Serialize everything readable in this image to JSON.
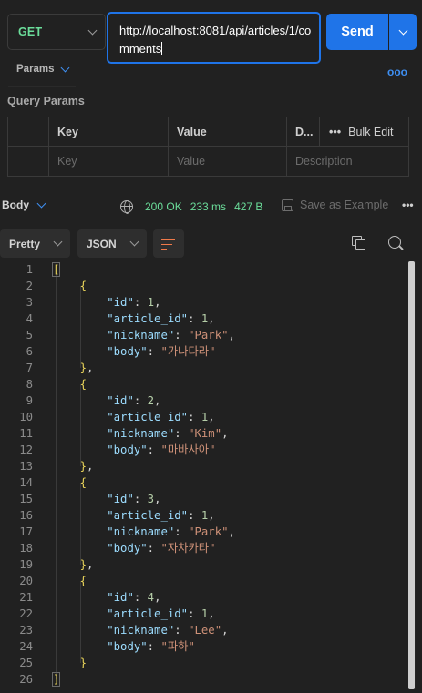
{
  "request": {
    "method": "GET",
    "url": "http://localhost:8081/api/articles/1/comments",
    "send_label": "Send"
  },
  "tabs": {
    "params_label": "Params",
    "more_label": "ooo"
  },
  "query_params": {
    "title": "Query Params",
    "headers": {
      "key": "Key",
      "value": "Value",
      "description": "D...",
      "bulk_edit": "Bulk Edit",
      "bulk_dots": "•••"
    },
    "placeholders": {
      "key": "Key",
      "value": "Value",
      "description": "Description"
    }
  },
  "response": {
    "body_label": "Body",
    "status": "200 OK",
    "time": "233 ms",
    "size": "427 B",
    "save_label": "Save as Example",
    "more_label": "•••",
    "view_mode": "Pretty",
    "format": "JSON"
  },
  "code_lines": [
    {
      "n": "1"
    },
    {
      "n": "2"
    },
    {
      "n": "3"
    },
    {
      "n": "4"
    },
    {
      "n": "5"
    },
    {
      "n": "6"
    },
    {
      "n": "7"
    },
    {
      "n": "8"
    },
    {
      "n": "9"
    },
    {
      "n": "10"
    },
    {
      "n": "11"
    },
    {
      "n": "12"
    },
    {
      "n": "13"
    },
    {
      "n": "14"
    },
    {
      "n": "15"
    },
    {
      "n": "16"
    },
    {
      "n": "17"
    },
    {
      "n": "18"
    },
    {
      "n": "19"
    },
    {
      "n": "20"
    },
    {
      "n": "21"
    },
    {
      "n": "22"
    },
    {
      "n": "23"
    },
    {
      "n": "24"
    },
    {
      "n": "25"
    },
    {
      "n": "26"
    }
  ],
  "comments": [
    {
      "id": "1",
      "article_id": "1",
      "nickname": "\"Park\"",
      "body": "\"가나다라\""
    },
    {
      "id": "2",
      "article_id": "1",
      "nickname": "\"Kim\"",
      "body": "\"마바사아\""
    },
    {
      "id": "3",
      "article_id": "1",
      "nickname": "\"Park\"",
      "body": "\"자차카타\""
    },
    {
      "id": "4",
      "article_id": "1",
      "nickname": "\"Lee\"",
      "body": "\"파하\""
    }
  ],
  "keys": {
    "id": "\"id\"",
    "article_id": "\"article_id\"",
    "nickname": "\"nickname\"",
    "body": "\"body\""
  },
  "colors": {
    "accent": "#1f74e8",
    "method": "#6bdd9a",
    "status_ok": "#6bdd9a",
    "json_key": "#9cdcfe",
    "json_string": "#ce9178",
    "json_number": "#b5cea8",
    "bracket": "#e8d35a"
  }
}
